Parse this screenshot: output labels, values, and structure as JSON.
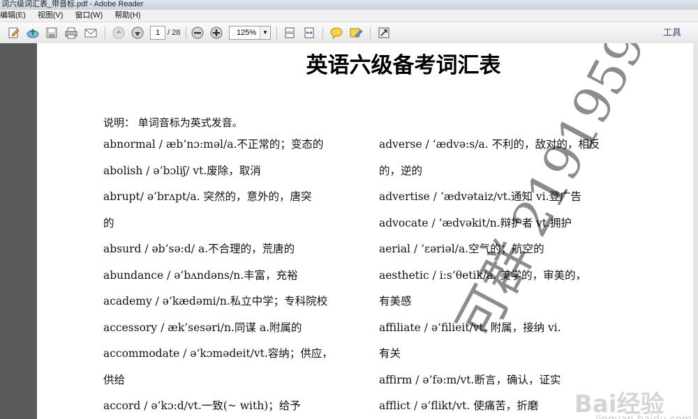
{
  "window": {
    "title": "词六级词汇表_带音标.pdf - Adobe Reader"
  },
  "menu": [
    "编辑(E)",
    "视图(V)",
    "窗口(W)",
    "帮助(H)"
  ],
  "toolbar": {
    "page_current": "1",
    "page_total": "/ 28",
    "zoom": "125%",
    "tools_label": "工具",
    "icons": [
      "edit-icon",
      "upload-icon",
      "save-icon",
      "print-icon",
      "email-icon",
      "previous-page-icon",
      "next-page-icon",
      "zoom-out-icon",
      "zoom-in-icon",
      "fit-page-icon",
      "fit-width-icon",
      "comment-icon",
      "highlight-icon",
      "full-screen-icon"
    ]
  },
  "document": {
    "title": "英语六级备考词汇表",
    "intro": "说明：  单词音标为英式发音。",
    "left_column": [
      "abnormal / æb’nɔ:məl/a.不正常的；变态的",
      "abolish / ə’bɔliʃ/ vt.废除，取消",
      "abrupt/ ə’brʌpt/a.  突然的，意外的，唐突",
      "的",
      "absurd / əb’sə:d/ a.不合理的，荒唐的",
      "abundance / ə’bʌndəns/n.丰富，充裕",
      "academy / ə’kædəmi/n.私立中学；专科院校",
      "accessory / æk’sesəri/n.同谋 a.附属的",
      "accommodate / ə’kɔmədeit/vt.容纳；供应，",
      "供给",
      "accord / ə’kɔ:d/vt.一致(~ with)；给予"
    ],
    "right_column": [
      "adverse /  ‘ædvə:s/a.  不利的，敌对的，相反",
      "的，逆的",
      "advertise /  ‘ædvətaiz/vt.通知 vi.登广告",
      "advocate /  ‘ædvəkit/n.辩护者 vt.拥护",
      "aerial /  ‘εəriəl/a.空气的；航空的",
      "aesthetic / i:s’θetik/a.  美学的，审美的，",
      "有美感",
      "affiliate / ə’filieit/vt.  附属，接纳 vi.",
      "有关",
      "affirm / ə’fə:m/vt.断言，确认，证实",
      "afflict / ə’flikt/vt.  使痛苦，折磨"
    ]
  },
  "watermarks": {
    "diagonal": "可群 2191959",
    "baidu_logo": "Bai经验",
    "baidu_url": "jingyan.baidu.com"
  },
  "colors": {
    "left_pane": "#5a5a5a",
    "tools_link": "#2a4f80"
  }
}
